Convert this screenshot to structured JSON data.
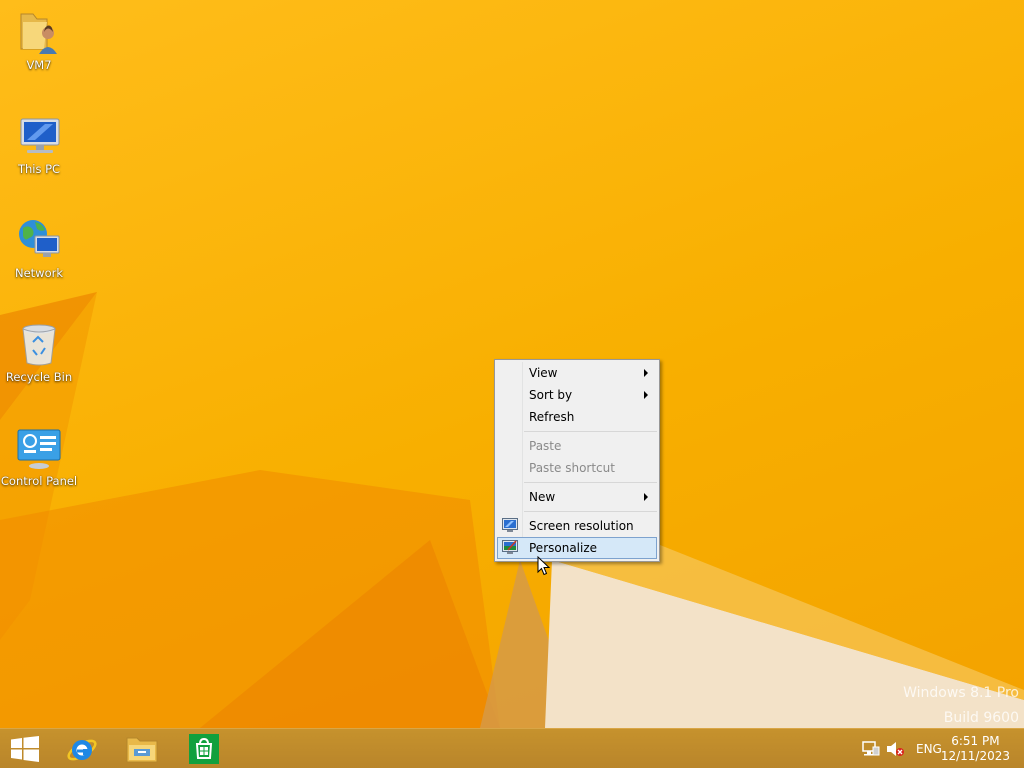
{
  "desktop": {
    "icons": [
      {
        "label": "VM7",
        "icon": "user-folder-icon"
      },
      {
        "label": "This PC",
        "icon": "computer-icon"
      },
      {
        "label": "Network",
        "icon": "network-icon"
      },
      {
        "label": "Recycle Bin",
        "icon": "recycle-bin-icon"
      },
      {
        "label": "Control Panel",
        "icon": "control-panel-icon"
      }
    ],
    "watermark": {
      "line1": "Windows 8.1 Pro",
      "line2": "Build 9600"
    }
  },
  "context_menu": {
    "items": [
      {
        "label": "View",
        "state": "enabled",
        "submenu": true
      },
      {
        "label": "Sort by",
        "state": "enabled",
        "submenu": true
      },
      {
        "label": "Refresh",
        "state": "enabled"
      },
      {
        "label": "Paste",
        "state": "disabled"
      },
      {
        "label": "Paste shortcut",
        "state": "disabled"
      },
      {
        "label": "New",
        "state": "enabled",
        "submenu": true
      },
      {
        "label": "Screen resolution",
        "state": "enabled",
        "icon": "display-icon"
      },
      {
        "label": "Personalize",
        "state": "hovered",
        "icon": "personalize-icon"
      }
    ]
  },
  "taskbar": {
    "pinned": [
      "start-button",
      "internet-explorer-icon",
      "file-explorer-icon",
      "store-icon"
    ],
    "tray": {
      "language": "ENG",
      "time": "6:51 PM",
      "date": "12/11/2023",
      "icons": [
        "network-status-icon",
        "volume-muted-icon"
      ]
    }
  },
  "colors": {
    "accent": "#f8af00",
    "taskbar": "#c0902c",
    "menu_highlight": "#d5e8f8"
  }
}
